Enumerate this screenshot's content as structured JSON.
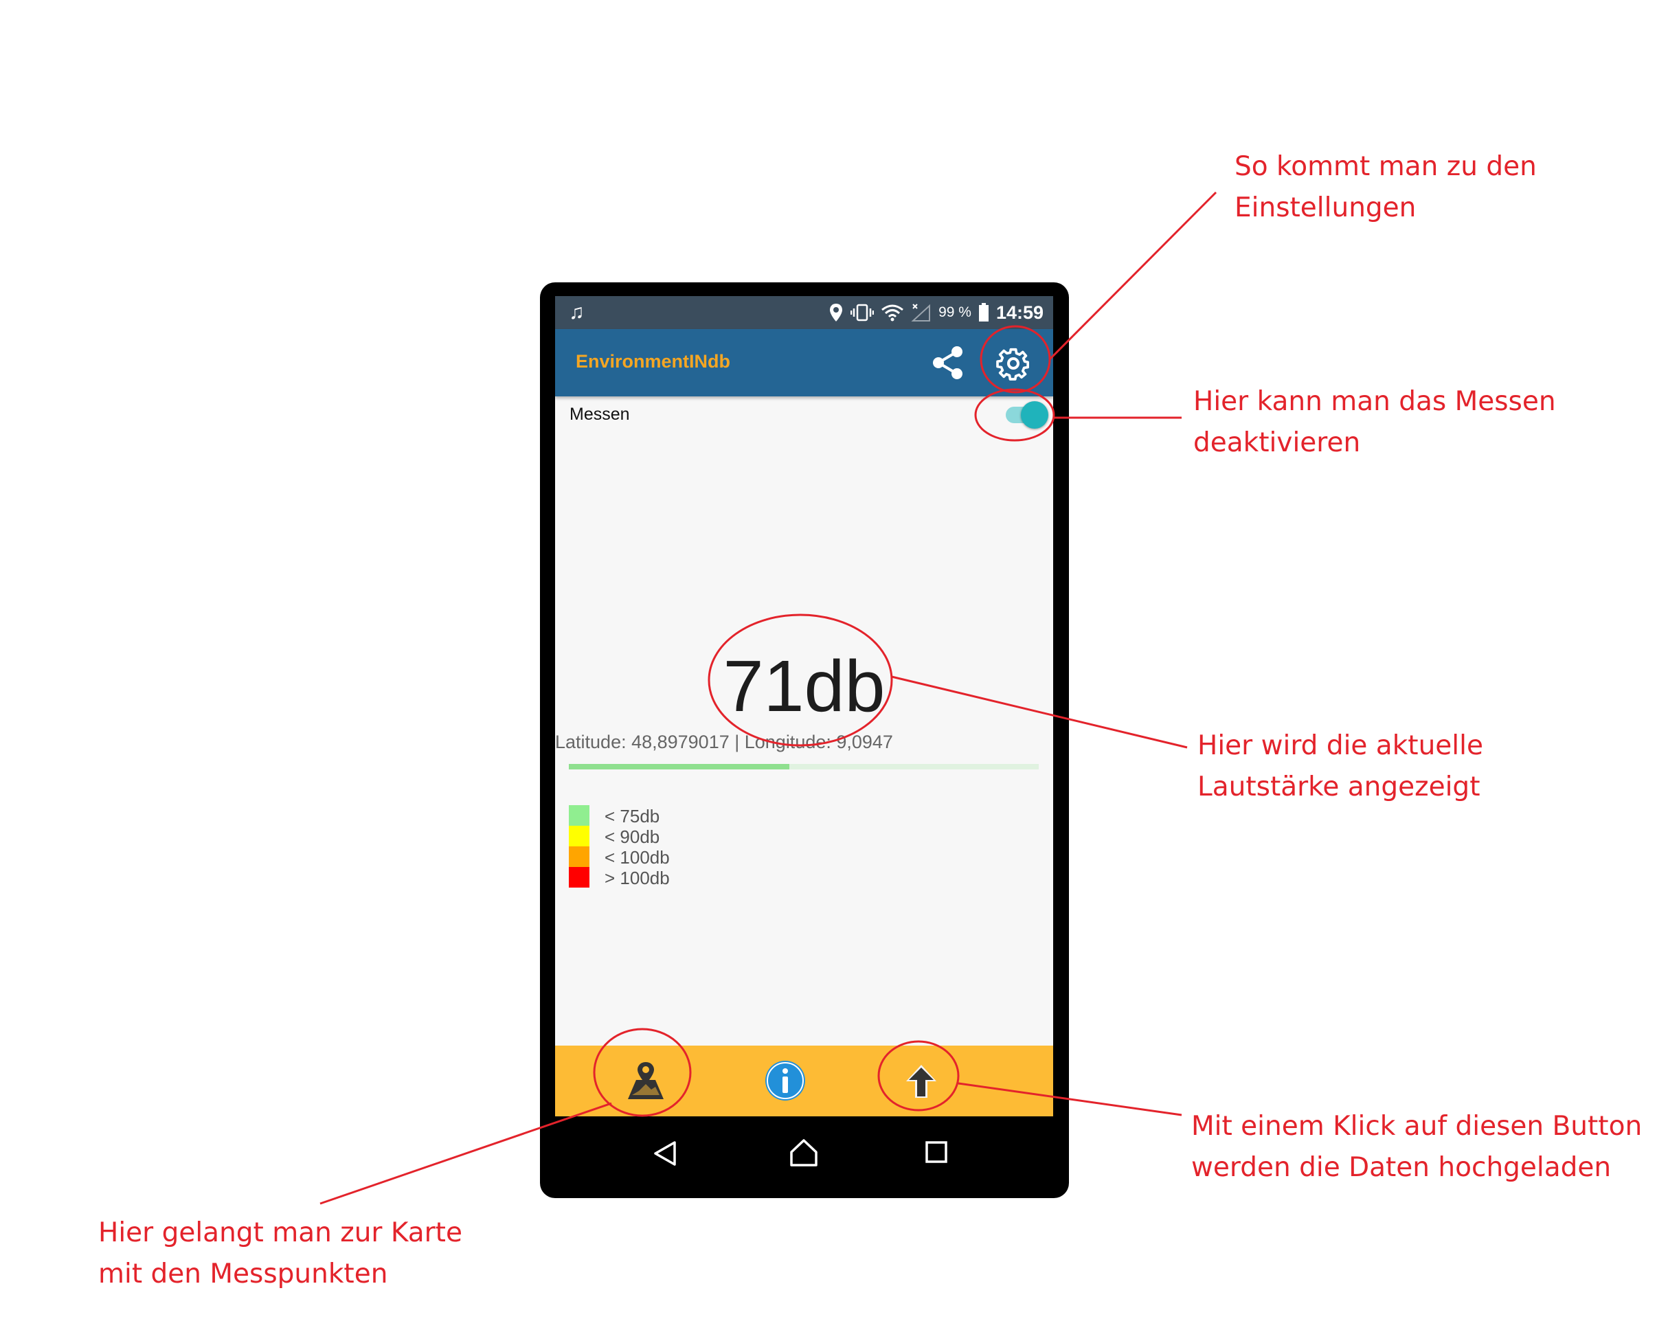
{
  "statusbar": {
    "left_icon": "music-note-icon",
    "icons": [
      "location-pin-icon",
      "vibrate-icon",
      "wifi-icon",
      "no-signal-icon"
    ],
    "battery_percent": "99 %",
    "time": "14:59"
  },
  "appbar": {
    "title": "EnvironmentINdb",
    "share_icon": "share-icon",
    "settings_icon": "gear-icon"
  },
  "measure": {
    "label": "Messen",
    "enabled": true
  },
  "reading": {
    "value": "71db",
    "coords": "Latitude: 48,8979017 | Longitude: 9,0947",
    "level_fraction": 0.47
  },
  "legend": [
    {
      "label": "< 75db",
      "color": "#90ee90"
    },
    {
      "label": "< 90db",
      "color": "#ffff00"
    },
    {
      "label": "< 100db",
      "color": "#ffa500"
    },
    {
      "label": "> 100db",
      "color": "#ff0000"
    }
  ],
  "bottom_nav": [
    "map-marker-icon",
    "info-icon",
    "upload-arrow-icon"
  ],
  "android_nav": [
    "back-icon",
    "home-icon",
    "recents-icon"
  ],
  "annotations": {
    "settings": [
      "So kommt man zu den",
      "Einstellungen"
    ],
    "toggle": [
      "Hier kann man das Messen",
      "deaktivieren"
    ],
    "value": [
      "Hier wird die aktuelle",
      "Lautstärke angezeigt"
    ],
    "upload": [
      "Mit einem Klick auf diesen Button",
      "werden die Daten hochgeladen"
    ],
    "map": [
      "Hier gelangt man zur Karte",
      "mit den Messpunkten"
    ]
  },
  "colors": {
    "appbar": "#246594",
    "title": "#f5a623",
    "bottombar": "#fdbb35",
    "annotation": "#e3232b"
  }
}
